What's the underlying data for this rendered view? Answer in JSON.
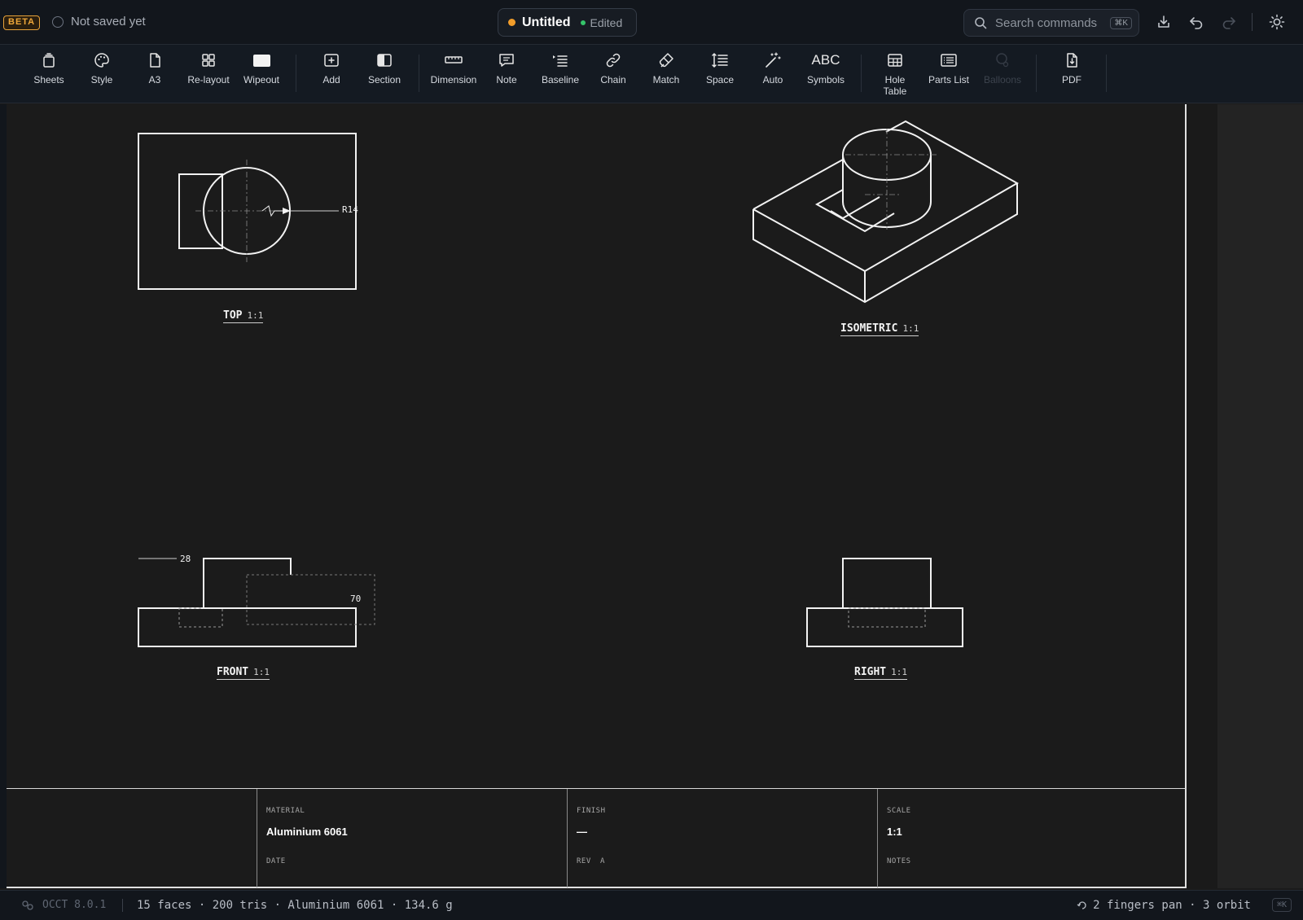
{
  "header": {
    "beta_badge": "BETA",
    "save_status": "Not saved yet",
    "doc_title": "Untitled",
    "edited_label": "Edited",
    "search_placeholder": "Search commands",
    "search_shortcut": "⌘K"
  },
  "toolbar": {
    "items": [
      {
        "label": "Sheets",
        "icon": "sheets-icon"
      },
      {
        "label": "Style",
        "icon": "palette-icon"
      },
      {
        "label": "A3",
        "icon": "page-icon"
      },
      {
        "label": "Re-layout",
        "icon": "grid-icon"
      },
      {
        "label": "Wipeout",
        "icon": "wipeout-icon"
      },
      {
        "label": "Add",
        "icon": "add-view-icon"
      },
      {
        "label": "Section",
        "icon": "section-icon"
      },
      {
        "label": "Dimension",
        "icon": "ruler-icon"
      },
      {
        "label": "Note",
        "icon": "note-icon"
      },
      {
        "label": "Baseline",
        "icon": "baseline-icon"
      },
      {
        "label": "Chain",
        "icon": "chain-icon"
      },
      {
        "label": "Match",
        "icon": "brush-icon"
      },
      {
        "label": "Space",
        "icon": "space-icon"
      },
      {
        "label": "Auto",
        "icon": "magic-wand-icon"
      },
      {
        "label": "Symbols",
        "icon": "abc-icon",
        "glyph": "ABC"
      },
      {
        "label": "Hole\nTable",
        "icon": "table-icon"
      },
      {
        "label": "Parts List",
        "icon": "list-icon"
      },
      {
        "label": "Balloons",
        "icon": "balloon-icon",
        "disabled": true
      },
      {
        "label": "PDF",
        "icon": "pdf-icon"
      }
    ]
  },
  "views": {
    "top": {
      "name": "TOP",
      "scale": "1:1",
      "dimension": "R14"
    },
    "isometric": {
      "name": "ISOMETRIC",
      "scale": "1:1"
    },
    "front": {
      "name": "FRONT",
      "scale": "1:1",
      "dim_a": "28",
      "dim_b": "70"
    },
    "right": {
      "name": "RIGHT",
      "scale": "1:1"
    }
  },
  "title_block": {
    "material_key": "MATERIAL",
    "material_value": "Aluminium 6061",
    "date_key": "DATE",
    "finish_key": "FINISH",
    "finish_value": "—",
    "rev_key": "REV",
    "rev_value": "A",
    "scale_key": "SCALE",
    "scale_value": "1:1",
    "notes_key": "NOTES"
  },
  "status_bar": {
    "engine": "OCCT 8.0.1",
    "stats": "15 faces · 200 tris · Aluminium 6061 · 134.6 g",
    "hint": "2 fingers pan · 3 orbit",
    "shortcut": "⌘K"
  }
}
